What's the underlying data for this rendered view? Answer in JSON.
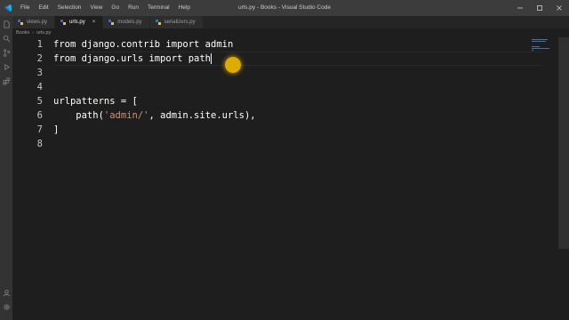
{
  "window": {
    "title": "urls.py - Books - Visual Studio Code"
  },
  "menu": [
    "File",
    "Edit",
    "Selection",
    "View",
    "Go",
    "Run",
    "Terminal",
    "Help"
  ],
  "tabs": [
    {
      "label": "views.py",
      "active": false
    },
    {
      "label": "urls.py",
      "active": true,
      "close": "×"
    },
    {
      "label": "models.py",
      "active": false
    },
    {
      "label": "serializers.py",
      "active": false
    }
  ],
  "breadcrumb": [
    "Books",
    "urls.py"
  ],
  "editor": {
    "lines": [
      {
        "n": "1",
        "text": "from django.contrib import admin"
      },
      {
        "n": "2",
        "text": "from django.urls import path"
      },
      {
        "n": "3",
        "text": ""
      },
      {
        "n": "4",
        "text": ""
      },
      {
        "n": "5",
        "text": "urlpatterns = ["
      },
      {
        "n": "6",
        "pre": "    path(",
        "str": "'admin/'",
        "post": ", admin.site.urls),"
      },
      {
        "n": "7",
        "text": "]"
      },
      {
        "n": "8",
        "text": ""
      }
    ]
  },
  "colors": {
    "editor_bg": "#1e1e1e",
    "titlebar_bg": "#3c3c3c",
    "string": "#ce9178",
    "cursor_highlight": "#ffc400"
  },
  "icons": [
    "vscode-logo-icon",
    "files-icon",
    "search-icon",
    "source-control-icon",
    "run-debug-icon",
    "extensions-icon",
    "account-icon",
    "settings-gear-icon"
  ]
}
